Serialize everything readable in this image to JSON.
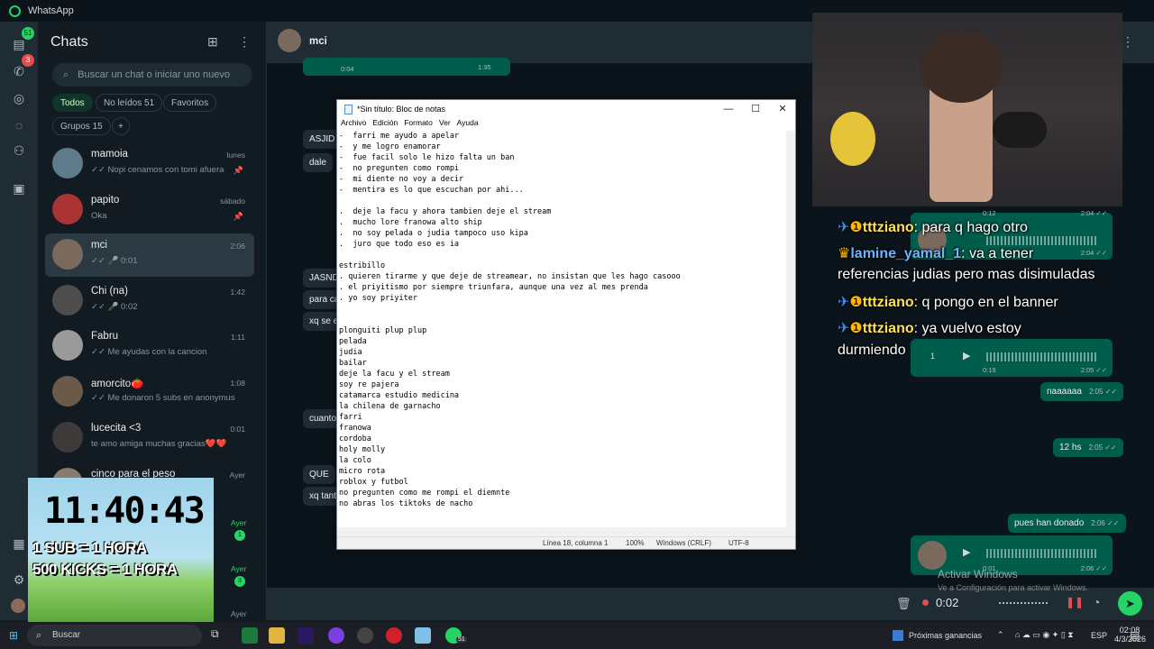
{
  "app_title": "WhatsApp",
  "rail": {
    "chats_badge": "51",
    "calls_badge": "3"
  },
  "sidebar": {
    "title": "Chats",
    "search_placeholder": "Buscar un chat o iniciar uno nuevo",
    "filters": [
      {
        "label": "Todos",
        "active": true
      },
      {
        "label": "No leídos 51"
      },
      {
        "label": "Favoritos"
      },
      {
        "label": "Grupos 15"
      }
    ],
    "add_filter": "+",
    "chats": [
      {
        "name": "mamoia",
        "time": "lunes",
        "preview": "✓✓ Nopi cenamos con tomi afuera",
        "pinned": true
      },
      {
        "name": "papito",
        "time": "sábado",
        "preview": "Oka",
        "pinned": true
      },
      {
        "name": "mci",
        "time": "2:06",
        "preview": "✓✓ 🎤 0:01",
        "selected": true
      },
      {
        "name": "Chi (na)",
        "time": "1:42",
        "preview": "✓✓ 🎤 0:02"
      },
      {
        "name": "Fabru",
        "time": "1:11",
        "preview": "✓✓ Me ayudas con la cancion"
      },
      {
        "name": "amorcito🍅",
        "time": "1:08",
        "preview": "✓✓ Me donaron 5 subs en anonymus"
      },
      {
        "name": "lucecita <3",
        "time": "0:01",
        "preview": "te amo amiga muchas gracias❤️❤️"
      },
      {
        "name": "cinco para el peso",
        "time": "Ayer",
        "preview": ""
      }
    ]
  },
  "chat": {
    "name": "mci",
    "bubbles": [
      {
        "text": "ASJID",
        "time": ""
      },
      {
        "text": "dale",
        "time": "2:"
      },
      {
        "text": "JASND",
        "time": ""
      },
      {
        "text": "para ca",
        "time": ""
      },
      {
        "text": "xq se e",
        "time": ""
      },
      {
        "text": "cuanto",
        "time": ""
      },
      {
        "text": "QUE",
        "time": "2:"
      },
      {
        "text": "xq tant",
        "time": ""
      }
    ],
    "top_times": [
      "0:04",
      "1:35"
    ],
    "out_msgs": [
      {
        "text": "naaaaaa",
        "time": "2:05 ✓✓"
      },
      {
        "text": "12 hs",
        "time": "2:05 ✓✓"
      },
      {
        "text": "pues han donado",
        "time": "2:06 ✓✓"
      }
    ],
    "voice_notes": [
      {
        "dur": "0:12",
        "time": "2:04 ✓✓"
      },
      {
        "dur": "",
        "time": "2:04 ✓✓"
      },
      {
        "speed": "1",
        "dur": "0:19",
        "time": "2:05 ✓✓"
      },
      {
        "dur": "0:01",
        "time": "2:06 ✓✓"
      }
    ],
    "recording_time": "0:02"
  },
  "notepad": {
    "title": "*Sin título: Bloc de notas",
    "menu": [
      "Archivo",
      "Edición",
      "Formato",
      "Ver",
      "Ayuda"
    ],
    "content": "-  farri me ayudo a apelar\n-  y me logro enamorar\n-  fue facil solo le hizo falta un ban\n-  no pregunten como rompi\n-  mi diente no voy a decir\n-  mentira es lo que escuchan por ahi...\n\n.  deje la facu y ahora tambien deje el stream\n.  mucho lore franowa alto ship\n.  no soy pelada o judia tampoco uso kipa\n.  juro que todo eso es ia\n\nestribillo\n. quieren tirarme y que deje de streamear, no insistan que les hago casooo\n. el priyitismo por siempre triunfara, aunque una vez al mes prenda\n. yo soy priyiter\n\n\nplonguiti plup plup\npelada\njudia\nbailar\ndeje la facu y el stream\nsoy re pajera\ncatamarca estudio medicina\nla chilena de garnacho\nfarri\nfranowa\ncordoba\nholy molly\nla colo\nmicro rota\nroblox y futbol\nno pregunten como me rompi el diemnte\nno abras los tiktoks de nacho",
    "status": {
      "position": "Línea 18, columna 1",
      "zoom": "100%",
      "eol": "Windows (CRLF)",
      "encoding": "UTF-8"
    }
  },
  "stream_chat": [
    {
      "user": "tttziano",
      "msg": ": para q hago otro"
    },
    {
      "user": "lamine_yamal_1",
      "msg": ": va a tener"
    },
    {
      "cont": "referencias judias pero mas disimuladas"
    },
    {
      "user": "tttziano",
      "msg": ": q pongo en el banner"
    },
    {
      "user": "tttziano",
      "msg": ": ya vuelvo estoy"
    },
    {
      "cont": "durmiendo"
    }
  ],
  "timer_overlay": {
    "time": "11:40:43",
    "line1": "1 SUB = 1 HORA",
    "line2": "500 KICKS = 1 HORA"
  },
  "watermark": {
    "line1": "Activar Windows",
    "line2": "Ve a Configuración para activar Windows."
  },
  "taskbar": {
    "search": "Buscar",
    "whatsapp_badge": "51",
    "news": "Próximas ganancias",
    "lang": "ESP",
    "clock_time": "02:08",
    "clock_date": "4/3/2026"
  },
  "colors": {
    "accent": "#25d366",
    "bubble_out": "#005c4b",
    "bubble_in": "#202c33"
  }
}
